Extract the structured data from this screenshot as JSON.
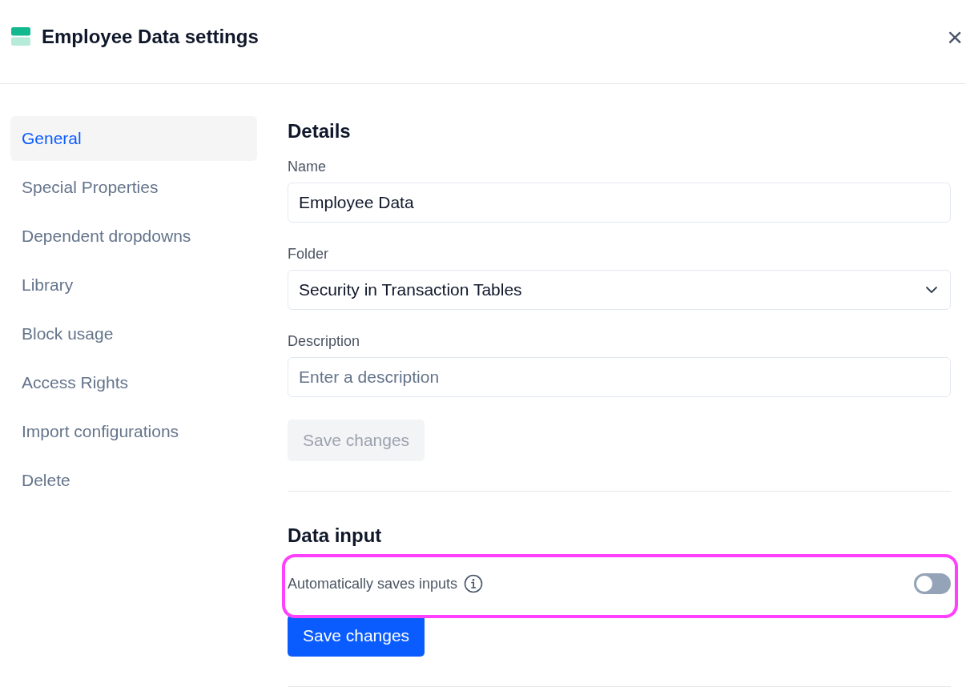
{
  "dialog": {
    "title": "Employee Data settings",
    "close_label": "×"
  },
  "sidebar": {
    "items": [
      {
        "label": "General",
        "selected": true
      },
      {
        "label": "Special Properties",
        "selected": false
      },
      {
        "label": "Dependent dropdowns",
        "selected": false
      },
      {
        "label": "Library",
        "selected": false
      },
      {
        "label": "Block usage",
        "selected": false
      },
      {
        "label": "Access Rights",
        "selected": false
      },
      {
        "label": "Import configurations",
        "selected": false
      },
      {
        "label": "Delete",
        "selected": false
      }
    ]
  },
  "sections": [
    {
      "heading": "Details",
      "fields": [
        {
          "kind": "text",
          "label": "Name",
          "value": "Employee Data"
        },
        {
          "kind": "select",
          "label": "Folder",
          "value": "Security in Transaction Tables"
        },
        {
          "kind": "text",
          "label": "Description",
          "placeholder": "Enter a description"
        }
      ],
      "button": {
        "label": "Save changes",
        "disabled": true
      }
    },
    {
      "heading": "Data input",
      "settings": [
        {
          "kind": "toggle",
          "label": "Automatically saves inputs",
          "on": false,
          "highlighted": true
        }
      ],
      "button": {
        "label": "Save changes",
        "disabled": false
      }
    }
  ]
}
